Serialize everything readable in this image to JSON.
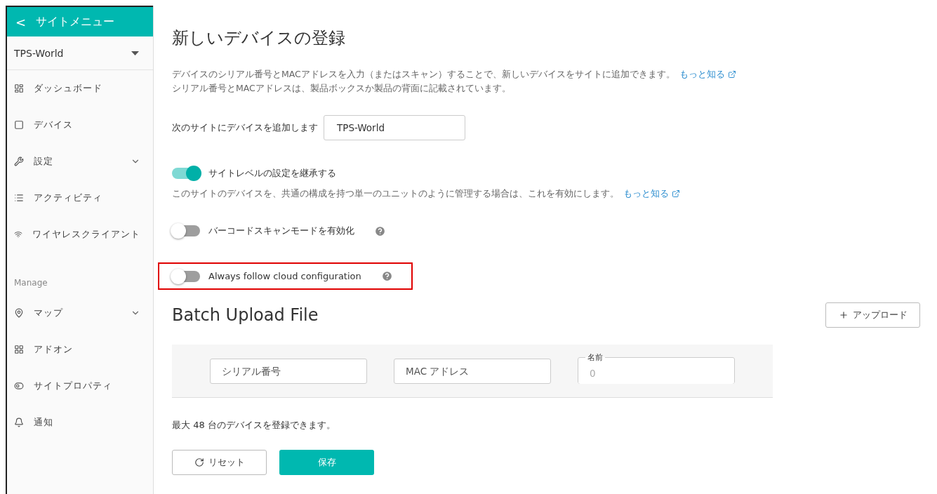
{
  "sidebar": {
    "header": {
      "icon_text": "<",
      "title": "サイトメニュー"
    },
    "site_selector": {
      "value": "TPS-World"
    },
    "items": [
      {
        "label": "ダッシュボード",
        "expandable": false
      },
      {
        "label": "デバイス",
        "expandable": false
      },
      {
        "label": "設定",
        "expandable": true
      },
      {
        "label": "アクティビティ",
        "expandable": false
      },
      {
        "label": "ワイヤレスクライアント",
        "expandable": false
      }
    ],
    "section_title": "Manage",
    "manage_items": [
      {
        "label": "マップ",
        "expandable": true
      },
      {
        "label": "アドオン",
        "expandable": false
      },
      {
        "label": "サイトプロパティ",
        "expandable": false
      },
      {
        "label": "通知",
        "expandable": false
      }
    ]
  },
  "main": {
    "title": "新しいデバイスの登録",
    "intro": {
      "line1": "デバイスのシリアル番号とMACアドレスを入力（またはスキャン）することで、新しいデバイスをサイトに追加できます。",
      "link": "もっと知る",
      "line2": "シリアル番号とMACアドレスは、製品ボックスか製品の背面に記載されています。"
    },
    "site_field": {
      "label": "次のサイトにデバイスを追加します",
      "value": "TPS-World"
    },
    "toggles": [
      {
        "label": "サイトレベルの設定を継承する",
        "on": true,
        "help": false,
        "highlighted": false,
        "description": "このサイトのデバイスを、共通の構成を持つ単一のユニットのように管理する場合は、これを有効にします。",
        "link": "もっと知る"
      },
      {
        "label": "バーコードスキャンモードを有効化",
        "on": false,
        "help": true,
        "highlighted": false
      },
      {
        "label": "Always follow cloud configuration",
        "on": false,
        "help": true,
        "highlighted": true
      }
    ],
    "batch": {
      "title": "Batch Upload File",
      "upload_button": "アップロード",
      "fields": [
        {
          "placeholder": "シリアル番号"
        },
        {
          "placeholder": "MAC アドレス"
        },
        {
          "label": "名前",
          "placeholder": "0"
        }
      ]
    },
    "note": "最大 48 台のデバイスを登録できます。",
    "buttons": [
      {
        "label": "リセット",
        "kind": "secondary"
      },
      {
        "label": "保存",
        "kind": "primary"
      }
    ]
  }
}
